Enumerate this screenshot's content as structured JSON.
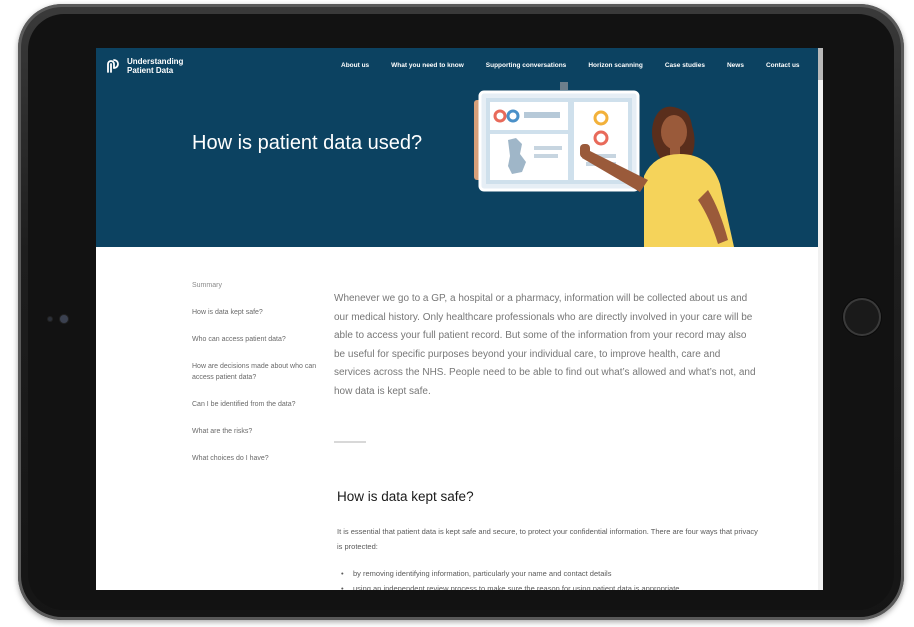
{
  "brand": {
    "line1": "Understanding",
    "line2": "Patient Data"
  },
  "nav": {
    "items": [
      "About us",
      "What you need to know",
      "Supporting conversations",
      "Horizon scanning",
      "Case studies",
      "News",
      "Contact us"
    ]
  },
  "hero": {
    "title": "How is patient data used?"
  },
  "toc": {
    "items": [
      "Summary",
      "How is data kept safe?",
      "Who can access patient data?",
      "How are decisions made about who can access patient data?",
      "Can I be identified from the data?",
      "What are the risks?",
      "What choices do I have?"
    ]
  },
  "main": {
    "intro": "Whenever we go to a GP, a hospital or a pharmacy, information will be collected about us and our medical history. Only healthcare professionals who are directly involved in your care will be able to access your full patient record. But some of the information from your record may also be useful for specific purposes beyond your individual care, to improve health, care and services across the NHS. People need to be able to find out what’s allowed and what’s not, and how data is kept safe.",
    "section_heading": "How is data kept safe?",
    "section_body": "It is essential that patient data is kept safe and secure, to protect your confidential information. There are four ways that privacy is protected:",
    "bullets": [
      "by removing identifying information, particularly your name and contact details",
      "using an independent review process to make sure the reason for using patient data is appropriate"
    ]
  },
  "colors": {
    "hero_bg": "#0c4261",
    "accent_yellow": "#f5d35a",
    "skin": "#9a5a3a"
  }
}
